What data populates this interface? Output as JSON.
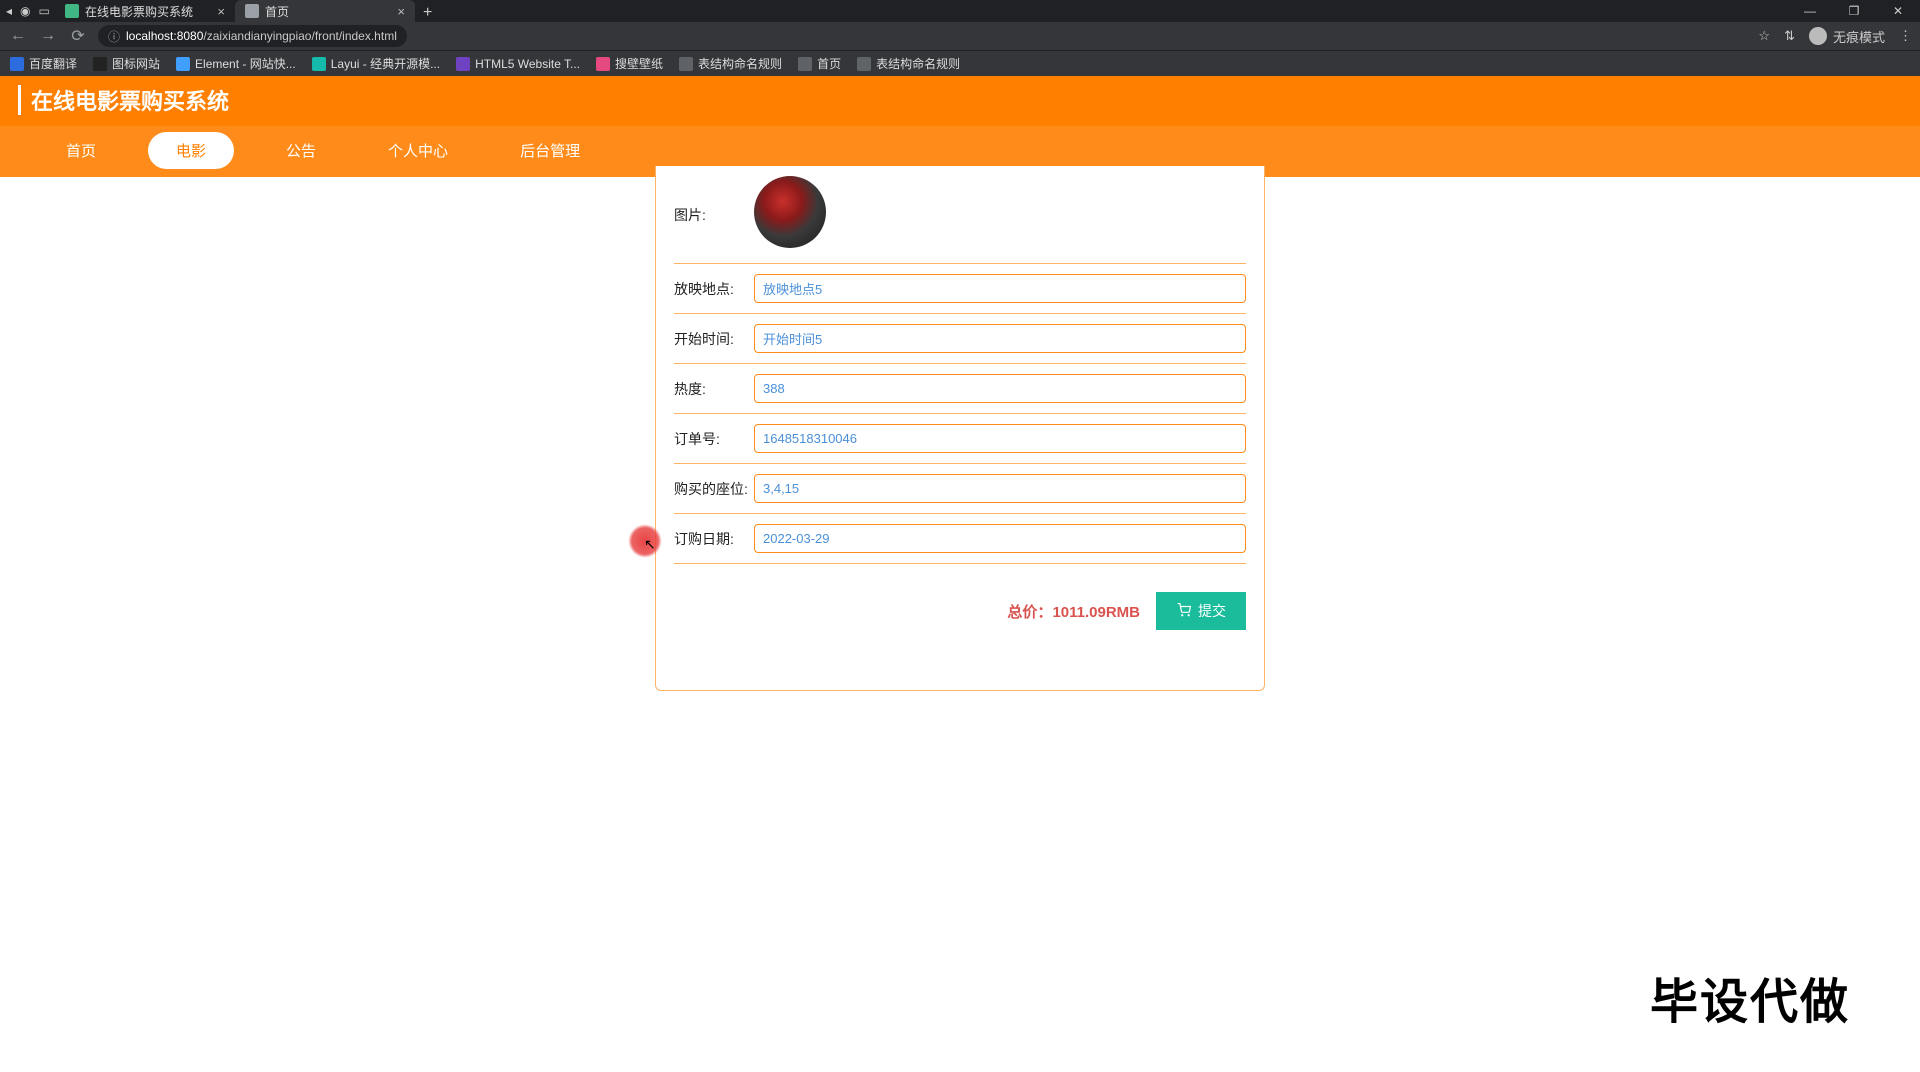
{
  "browser": {
    "tabs": [
      {
        "title": "在线电影票购买系统",
        "active": false,
        "favicon_color": "#41b883"
      },
      {
        "title": "首页",
        "active": true,
        "favicon_color": "#9aa0a6"
      }
    ],
    "url_host": "localhost:8080",
    "url_path": "/zaixiandianyingpiao/front/index.html",
    "star": "☆",
    "incognito_label": "无痕模式",
    "window": {
      "min": "—",
      "max": "❐",
      "close": "✕"
    },
    "nav": {
      "back": "←",
      "forward": "→",
      "reload": "⟳"
    },
    "toolbar_extra": "⇅"
  },
  "bookmarks": [
    {
      "label": "百度翻译",
      "color": "#2d6cdf"
    },
    {
      "label": "图标网站",
      "color": "#222"
    },
    {
      "label": "Element - 网站快...",
      "color": "#409eff"
    },
    {
      "label": "Layui - 经典开源模...",
      "color": "#16baaa"
    },
    {
      "label": "HTML5 Website T...",
      "color": "#6f42c1"
    },
    {
      "label": "搜壁壁纸",
      "color": "#e64980"
    },
    {
      "label": "表结构命名规则",
      "color": "#5f6368"
    },
    {
      "label": "首页",
      "color": "#5f6368"
    },
    {
      "label": "表结构命名规则",
      "color": "#5f6368"
    }
  ],
  "site": {
    "title": "在线电影票购买系统",
    "nav": {
      "home": "首页",
      "movie": "电影",
      "notice": "公告",
      "user_center": "个人中心",
      "admin": "后台管理"
    }
  },
  "form": {
    "image_label": "图片:",
    "location_label": "放映地点:",
    "location_value": "放映地点5",
    "start_label": "开始时间:",
    "start_value": "开始时间5",
    "heat_label": "热度:",
    "heat_value": "388",
    "order_label": "订单号:",
    "order_value": "1648518310046",
    "seats_label": "购买的座位:",
    "seats_value": "3,4,15",
    "date_label": "订购日期:",
    "date_value": "2022-03-29"
  },
  "summary": {
    "total_label": "总价：",
    "total_value": "1011.09RMB",
    "submit": "提交"
  },
  "watermark": "毕设代做"
}
